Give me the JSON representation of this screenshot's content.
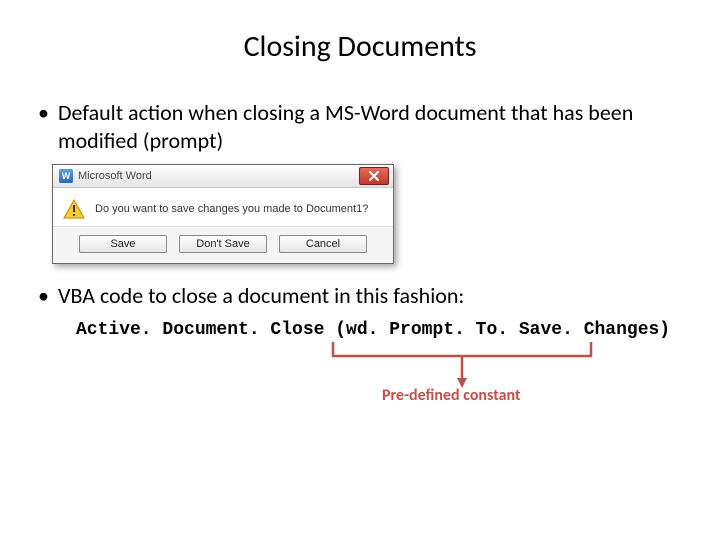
{
  "title": "Closing Documents",
  "bullets": {
    "b1": "Default action when closing a MS-Word document that has been modified (prompt)",
    "b2": "VBA code to close a document in this fashion:"
  },
  "dialog": {
    "app_name": "Microsoft Word",
    "message": "Do you want to save changes you made to Document1?",
    "btn_save": "Save",
    "btn_dont": "Don't Save",
    "btn_cancel": "Cancel"
  },
  "code": {
    "part1": "Active. Document. Close ",
    "part2": "(wd. Prompt. To. Save. Changes)"
  },
  "annotation": "Pre-defined constant",
  "colors": {
    "callout": "#c0504d"
  }
}
